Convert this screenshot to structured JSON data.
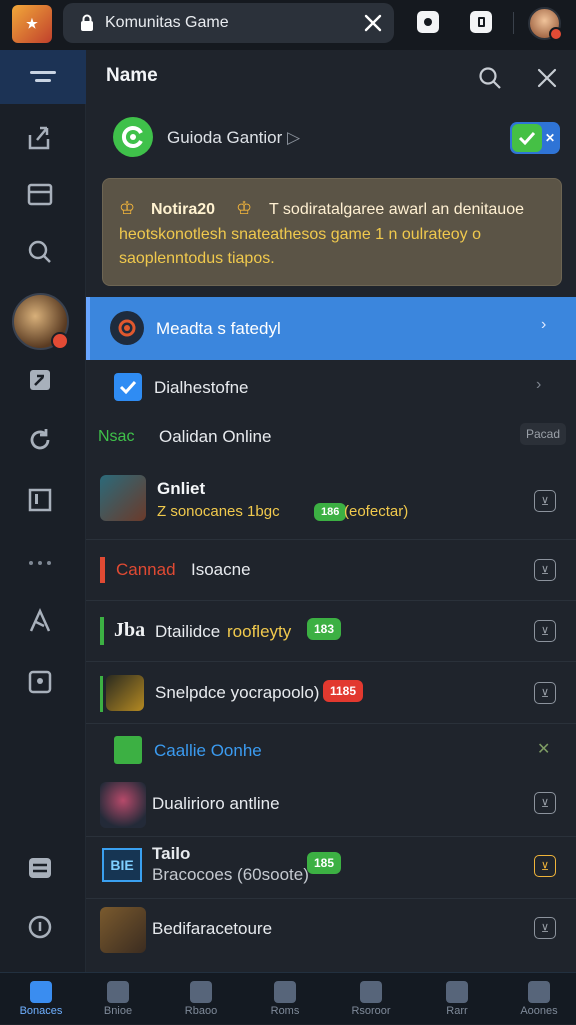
{
  "browser": {
    "url_text": "Komunitas Game",
    "close_icon": "close-icon"
  },
  "panel": {
    "title": "Name",
    "guide_label": "Guioda Gantior",
    "guide_toggle_on": true
  },
  "notice": {
    "title": "Notira20",
    "line1": "T sodiratalgaree awarl an denitauoe",
    "line2": "heotskonotlesh snateathesos game 1 n oulrateoy o",
    "line3": "saoplenntodus tiapos."
  },
  "rows": {
    "highlight": "Meadta s fatedyl",
    "checkbox": "Dialhestofne",
    "section_prefix": "Nsac",
    "section_title": "Oalidan Online",
    "section_tag": "Pacad",
    "item1_title": "Gnliet",
    "item1_sub": "Z  sonocanes  1bgc",
    "item1_badge": "186",
    "item1_extra": "(eofectar)",
    "item2_red": "Cannad",
    "item2_rest": "Isoacne",
    "item3_jb": "Jba",
    "item3_label": "Dtailidce",
    "item3_yellow": "roofleyty",
    "item3_badge": "183",
    "item4_label": "Snelpdce yocrapoolo)",
    "item4_badge": "1185",
    "item5_label": "Caallie Oonhe",
    "item6_label": "Dualirioro antline",
    "item7_title": "Tailo",
    "item7_sub": "Bracocoes (60soote)",
    "item7_badge": "185",
    "item8_label": "Bedifaracetoure"
  },
  "nav": [
    {
      "label": "Bonaces"
    },
    {
      "label": "Bnioe"
    },
    {
      "label": "Rbaoo"
    },
    {
      "label": "Roms"
    },
    {
      "label": "Rsoroor"
    },
    {
      "label": "Rarr"
    },
    {
      "label": "Aoones"
    }
  ],
  "colors": {
    "accent_blue": "#3b86dd",
    "green_badge": "#3cb043",
    "red_badge": "#e2392f"
  }
}
